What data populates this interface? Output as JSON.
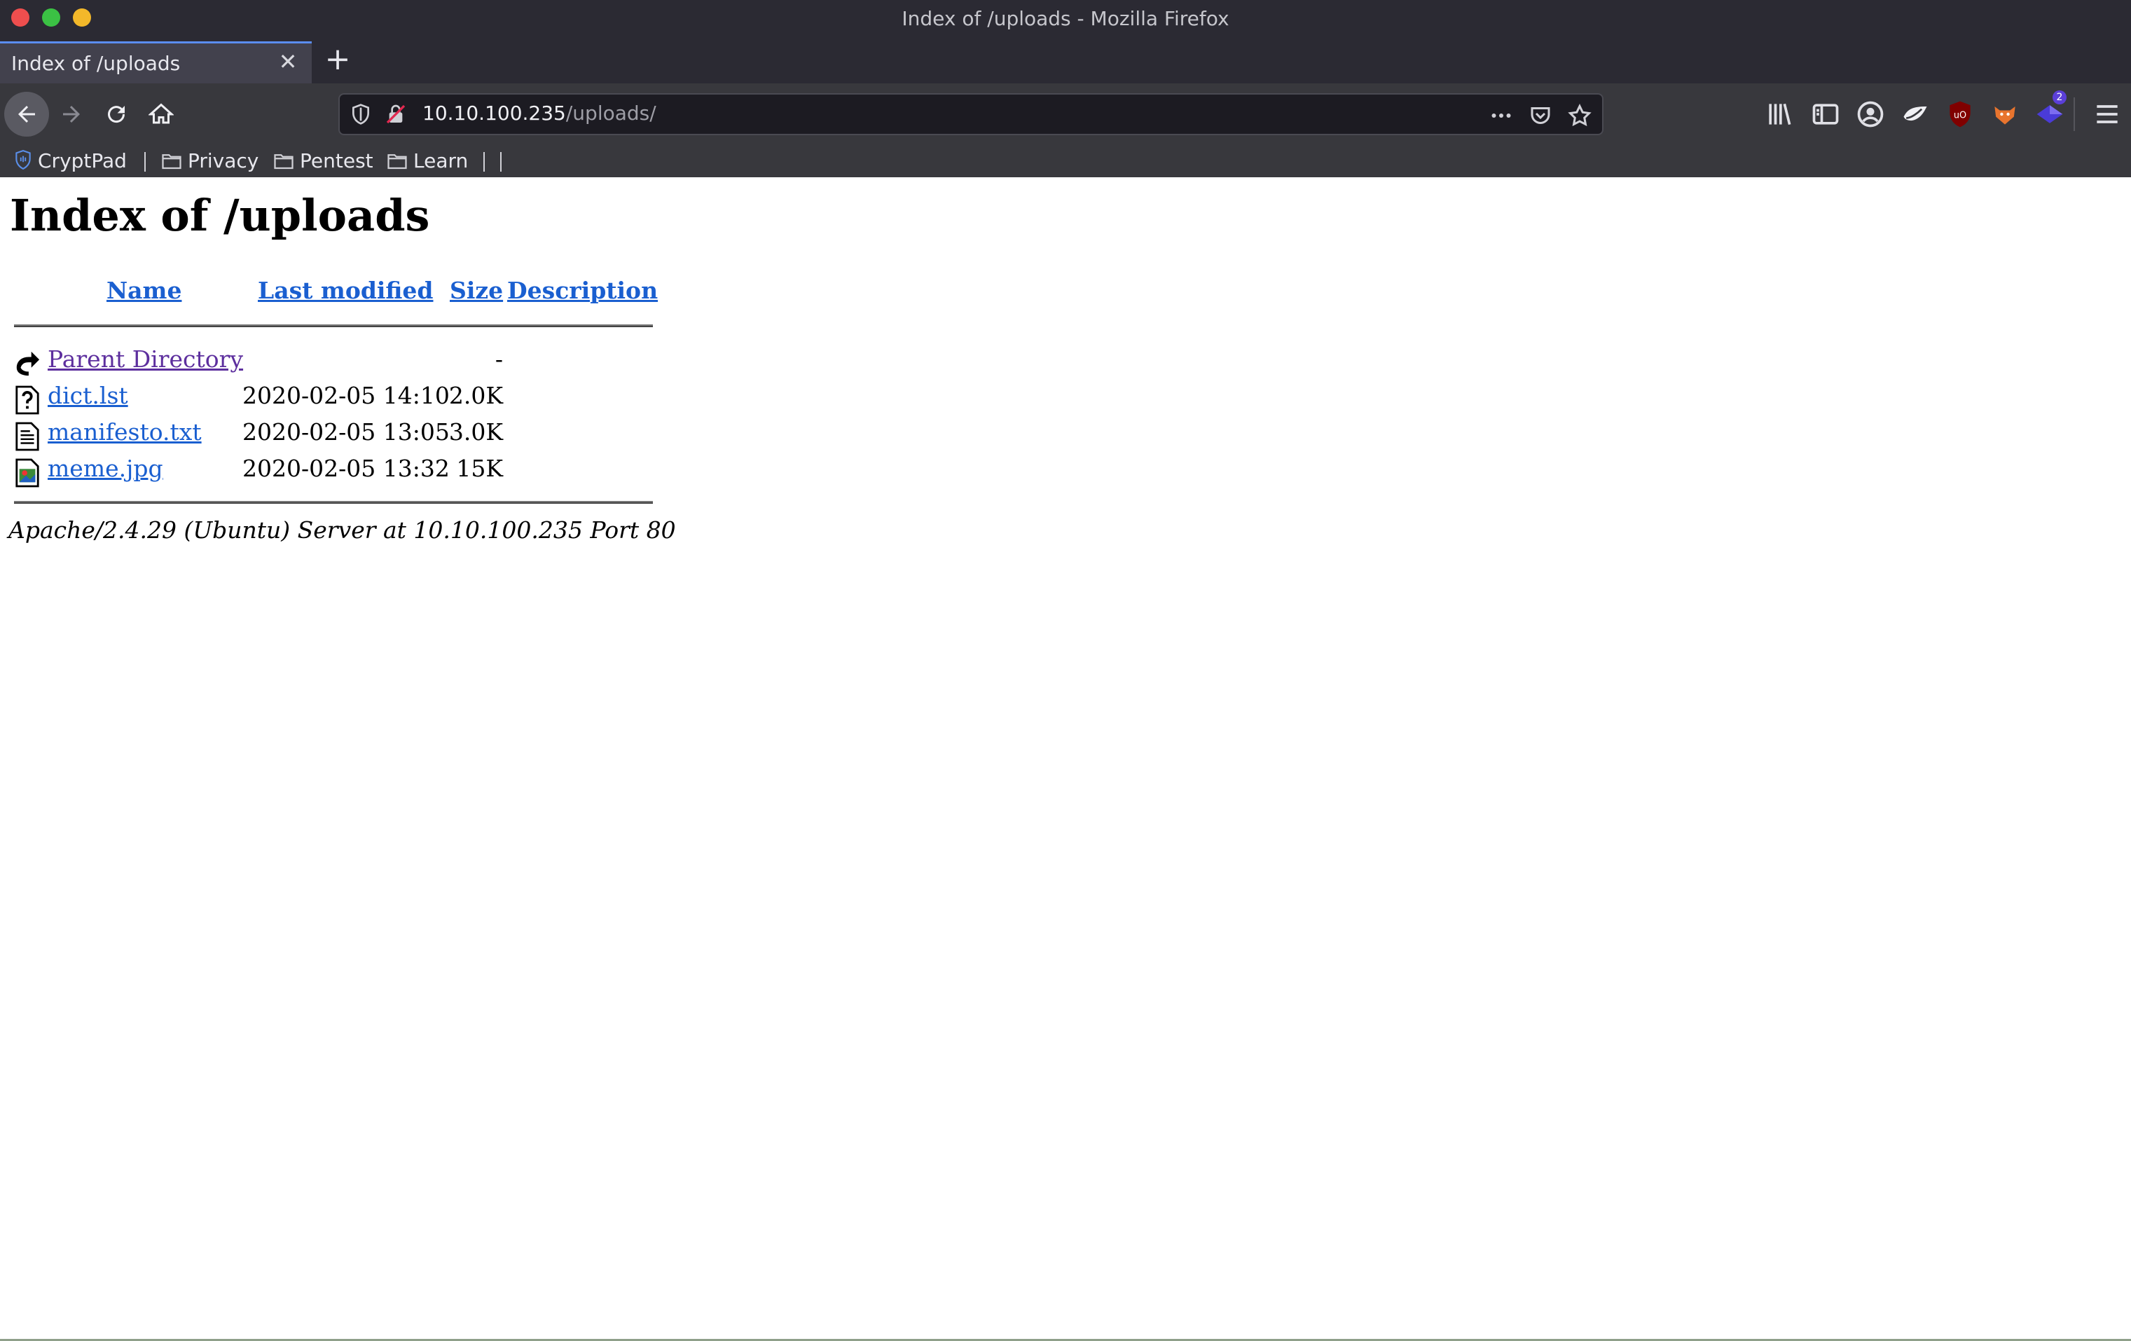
{
  "window": {
    "title": "Index of /uploads - Mozilla Firefox",
    "traffic_colors": [
      "#ee4e4e",
      "#3bc144",
      "#f3b82a"
    ]
  },
  "tab": {
    "title": "Index of /uploads",
    "close_glyph": "✕",
    "newtab_glyph": "+"
  },
  "urlbar": {
    "host": "10.10.100.235",
    "path": "/uploads/"
  },
  "toolbar_icons": [
    "library-icon",
    "sidebar-icon",
    "account-icon",
    "extension-icon",
    "ublock-icon",
    "foxyproxy-icon",
    "extension-badge-icon",
    "menu-icon"
  ],
  "extension_badge": "2",
  "bookmarks": [
    {
      "label": "CryptPad",
      "icon": "cryptpad-icon"
    },
    {
      "label": "Privacy",
      "icon": "folder-icon"
    },
    {
      "label": "Pentest",
      "icon": "folder-icon"
    },
    {
      "label": "Learn",
      "icon": "folder-icon"
    }
  ],
  "page": {
    "heading": "Index of /uploads",
    "columns": {
      "name": "Name",
      "modified": "Last modified",
      "size": "Size",
      "description": "Description"
    },
    "parent": {
      "name": "Parent Directory",
      "size": "-"
    },
    "files": [
      {
        "name": "dict.lst",
        "modified": "2020-02-05 14:10",
        "size": "2.0K",
        "icon": "unknown-file-icon"
      },
      {
        "name": "manifesto.txt",
        "modified": "2020-02-05 13:05",
        "size": "3.0K",
        "icon": "text-file-icon"
      },
      {
        "name": "meme.jpg",
        "modified": "2020-02-05 13:32",
        "size": "15K",
        "icon": "image-file-icon"
      }
    ],
    "signature": "Apache/2.4.29 (Ubuntu) Server at 10.10.100.235 Port 80"
  }
}
